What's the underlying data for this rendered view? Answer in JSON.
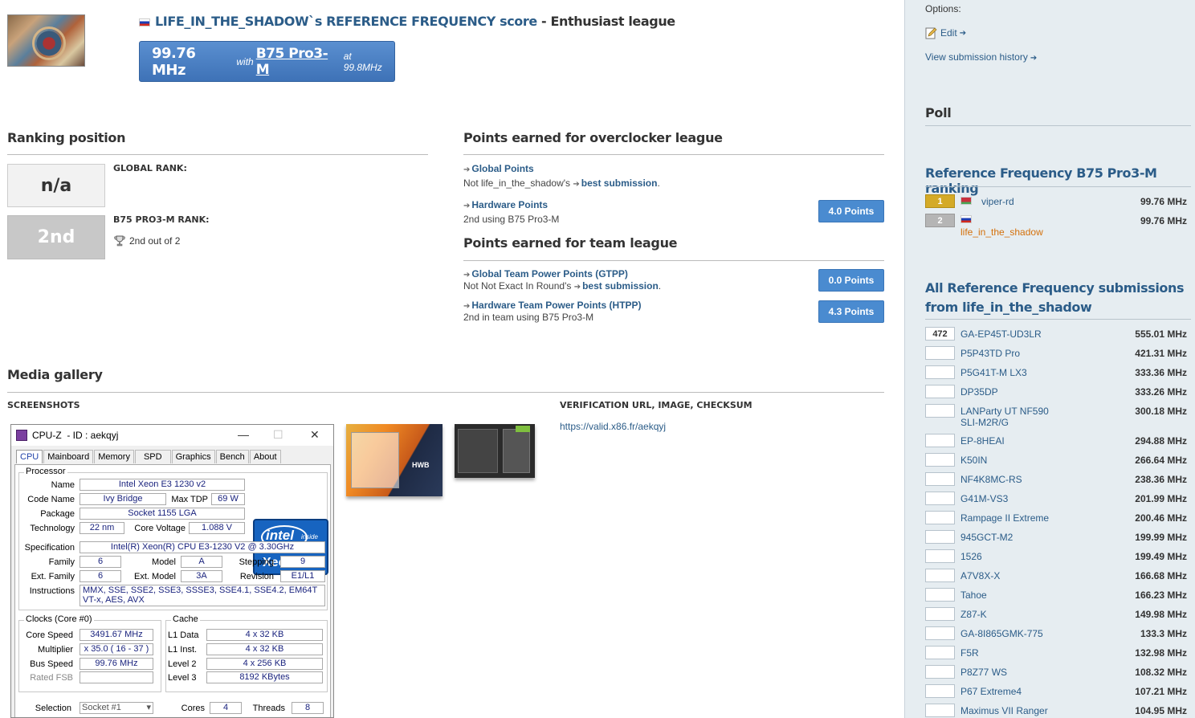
{
  "header": {
    "username": "LIFE_IN_THE_SHADOW",
    "title_mid": "`s REFERENCE FREQUENCY score",
    "title_sep": " - ",
    "league": "Enthusiast league",
    "score_value": "99.76 MHz",
    "score_with": "with",
    "score_board": "B75 Pro3-M",
    "score_at": "at 99.8MHz"
  },
  "ranking": {
    "heading": "Ranking position",
    "global_label": "GLOBAL RANK:",
    "global_value": "n/a",
    "hw_label": "B75 PRO3-M RANK:",
    "hw_value": "2nd",
    "hw_detail": "2nd out of 2"
  },
  "overclocker_points": {
    "heading": "Points earned for overclocker league",
    "global_title": "Global Points",
    "global_sub_prefix": "Not life_in_the_shadow's",
    "global_sub_link": "best submission",
    "hw_title": "Hardware Points",
    "hw_sub": "2nd using B75 Pro3-M",
    "hw_points": "4.0 Points"
  },
  "team_points": {
    "heading": "Points earned for team league",
    "gtpp_title": "Global Team Power Points (GTPP)",
    "gtpp_sub_prefix": "Not Not Exact In Round's",
    "gtpp_sub_link": "best submission",
    "gtpp_points": "0.0 Points",
    "htpp_title": "Hardware Team Power Points (HTPP)",
    "htpp_sub": "2nd in team using B75 Pro3-M",
    "htpp_points": "4.3 Points"
  },
  "media": {
    "heading": "Media gallery",
    "screenshots_label": "SCREENSHOTS",
    "verification_label": "VERIFICATION URL, IMAGE, CHECKSUM",
    "verification_url": "https://valid.x86.fr/aekqyj"
  },
  "cpuz": {
    "title": "CPU-Z",
    "id": "- ID : aekqyj",
    "tabs": [
      "CPU",
      "Mainboard",
      "Memory",
      "SPD",
      "Graphics",
      "Bench",
      "About"
    ],
    "processor_legend": "Processor",
    "name_label": "Name",
    "name": "Intel Xeon E3 1230 v2",
    "codename_label": "Code Name",
    "codename": "Ivy Bridge",
    "maxtdp_label": "Max TDP",
    "maxtdp": "69 W",
    "package_label": "Package",
    "package": "Socket 1155 LGA",
    "technology_label": "Technology",
    "technology": "22 nm",
    "corevoltage_label": "Core Voltage",
    "corevoltage": "1.088 V",
    "spec_label": "Specification",
    "spec": "Intel(R) Xeon(R) CPU E3-1230 V2 @ 3.30GHz",
    "family_label": "Family",
    "family": "6",
    "model_label": "Model",
    "model": "A",
    "stepping_label": "Stepping",
    "stepping": "9",
    "extfamily_label": "Ext. Family",
    "extfamily": "6",
    "extmodel_label": "Ext. Model",
    "extmodel": "3A",
    "revision_label": "Revision",
    "revision": "E1/L1",
    "instructions_label": "Instructions",
    "instructions": "MMX, SSE, SSE2, SSE3, SSSE3, SSE4.1, SSE4.2, EM64T VT-x, AES, AVX",
    "clocks_legend": "Clocks (Core #0)",
    "corespeed_label": "Core Speed",
    "corespeed": "3491.67 MHz",
    "multiplier_label": "Multiplier",
    "multiplier": "x 35.0 ( 16 - 37 )",
    "busspeed_label": "Bus Speed",
    "busspeed": "99.76 MHz",
    "ratedfsb_label": "Rated FSB",
    "cache_legend": "Cache",
    "l1data_label": "L1 Data",
    "l1data": "4 x 32 KB",
    "l1inst_label": "L1 Inst.",
    "l1inst": "4 x 32 KB",
    "level2_label": "Level 2",
    "level2": "4 x 256 KB",
    "level3_label": "Level 3",
    "level3": "8192 KBytes",
    "selection_label": "Selection",
    "selection": "Socket #1",
    "cores_label": "Cores",
    "cores": "4",
    "threads_label": "Threads",
    "threads": "8",
    "intel_brand": "intel",
    "intel_inside": "inside",
    "intel_xeon": "Xeon"
  },
  "sidebar": {
    "options_label": "Options:",
    "edit_label": "Edit",
    "history_label": "View submission history",
    "poll_heading": "Poll",
    "ranking_heading": "Reference Frequency B75 Pro3-M ranking",
    "ranking": [
      {
        "rank": "1",
        "name": "viper-rd",
        "value": "99.76 MHz"
      },
      {
        "rank": "2",
        "name": "life_in_the_shadow",
        "value": "99.76 MHz"
      }
    ],
    "all_heading": "All Reference Frequency submissions from life_in_the_shadow",
    "submissions": [
      {
        "rank": "472",
        "name": "GA-EP45T-UD3LR",
        "value": "555.01 MHz"
      },
      {
        "rank": "",
        "name": "P5P43TD Pro",
        "value": "421.31 MHz"
      },
      {
        "rank": "",
        "name": "P5G41T-M LX3",
        "value": "333.36 MHz"
      },
      {
        "rank": "",
        "name": "DP35DP",
        "value": "333.26 MHz"
      },
      {
        "rank": "",
        "name": "LANParty UT NF590 SLI-M2R/G",
        "value": "300.18 MHz"
      },
      {
        "rank": "",
        "name": "EP-8HEAI",
        "value": "294.88 MHz"
      },
      {
        "rank": "",
        "name": "K50IN",
        "value": "266.64 MHz"
      },
      {
        "rank": "",
        "name": "NF4K8MC-RS",
        "value": "238.36 MHz"
      },
      {
        "rank": "",
        "name": "G41M-VS3",
        "value": "201.99 MHz"
      },
      {
        "rank": "",
        "name": "Rampage II Extreme",
        "value": "200.46 MHz"
      },
      {
        "rank": "",
        "name": "945GCT-M2",
        "value": "199.99 MHz"
      },
      {
        "rank": "",
        "name": "1526",
        "value": "199.49 MHz"
      },
      {
        "rank": "",
        "name": "A7V8X-X",
        "value": "166.68 MHz"
      },
      {
        "rank": "",
        "name": "Tahoe",
        "value": "166.23 MHz"
      },
      {
        "rank": "",
        "name": "Z87-K",
        "value": "149.98 MHz"
      },
      {
        "rank": "",
        "name": "GA-8I865GMK-775",
        "value": "133.3 MHz"
      },
      {
        "rank": "",
        "name": "F5R",
        "value": "132.98 MHz"
      },
      {
        "rank": "",
        "name": "P8Z77 WS",
        "value": "108.32 MHz"
      },
      {
        "rank": "",
        "name": "P67 Extreme4",
        "value": "107.21 MHz"
      },
      {
        "rank": "",
        "name": "Maximus VII Ranger",
        "value": "104.95 MHz"
      }
    ]
  }
}
